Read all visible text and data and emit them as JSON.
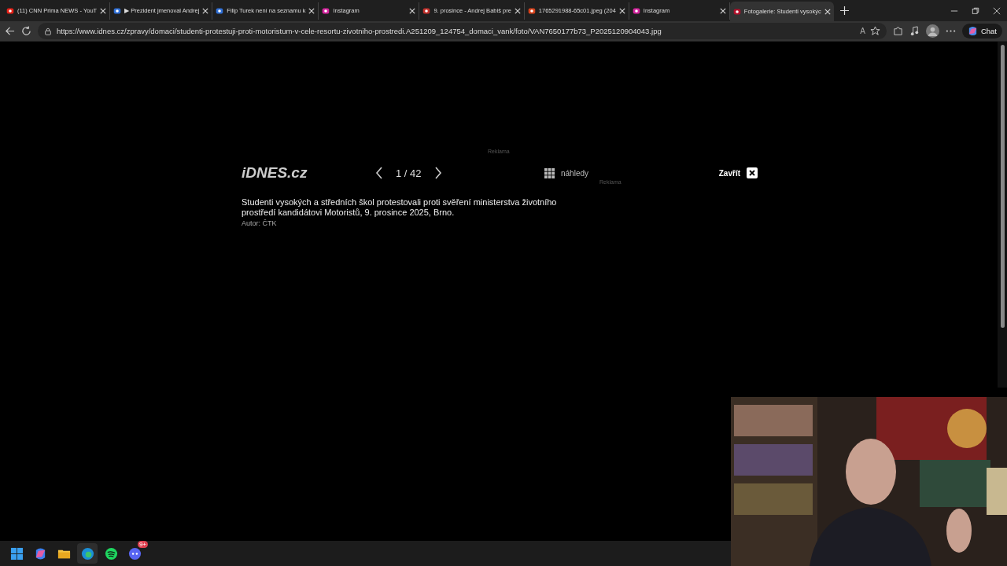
{
  "tabs": [
    {
      "title": "(11) CNN Prima NEWS - YouT",
      "kind": "youtube",
      "selected": false
    },
    {
      "title": "▶ Prezident jmenoval Andrej",
      "kind": "site",
      "selected": false
    },
    {
      "title": "Filip Turek není na seznamu k",
      "kind": "site",
      "selected": false
    },
    {
      "title": "Instagram",
      "kind": "instagram",
      "selected": false
    },
    {
      "title": "9. prosince - Andrej Babiš pre",
      "kind": "news",
      "selected": false
    },
    {
      "title": "1765291988-65c01.jpeg (204",
      "selected": false
    },
    {
      "title": "Instagram",
      "kind": "instagram",
      "selected": false
    },
    {
      "title": "Fotogalerie: Studenti vysokýc",
      "kind": "idnes",
      "selected": true
    }
  ],
  "address_bar": {
    "url": "https://www.idnes.cz/zpravy/domaci/studenti-protestuji-proti-motoristum-v-cele-resortu-zivotniho-prostredi.A251209_124754_domaci_vank/foto/VAN7650177b73_P2025120904043.jpg"
  },
  "toolbar": {
    "read_aloud": "A",
    "chat": "Chat"
  },
  "gallery": {
    "ad_label_top": "Reklama",
    "logo": "iDNES.cz",
    "counter": "1 / 42",
    "thumbnails": "náhledy",
    "ad_label_right": "Reklama",
    "close": "Zavřít",
    "caption": "Studenti vysokých a středních škol protestovali proti svěření ministerstva životního prostředí kandidátovi Motoristů, 9. prosince 2025, Brno.",
    "author": "Autor: ČTK"
  },
  "taskbar": {
    "apps": [
      {
        "kind": "start",
        "selected": false
      },
      {
        "kind": "copilot",
        "selected": false
      },
      {
        "kind": "files",
        "selected": false
      },
      {
        "kind": "edge",
        "selected": true
      },
      {
        "kind": "spotify",
        "selected": false
      },
      {
        "kind": "discord",
        "selected": false,
        "badge": "9+"
      }
    ]
  }
}
